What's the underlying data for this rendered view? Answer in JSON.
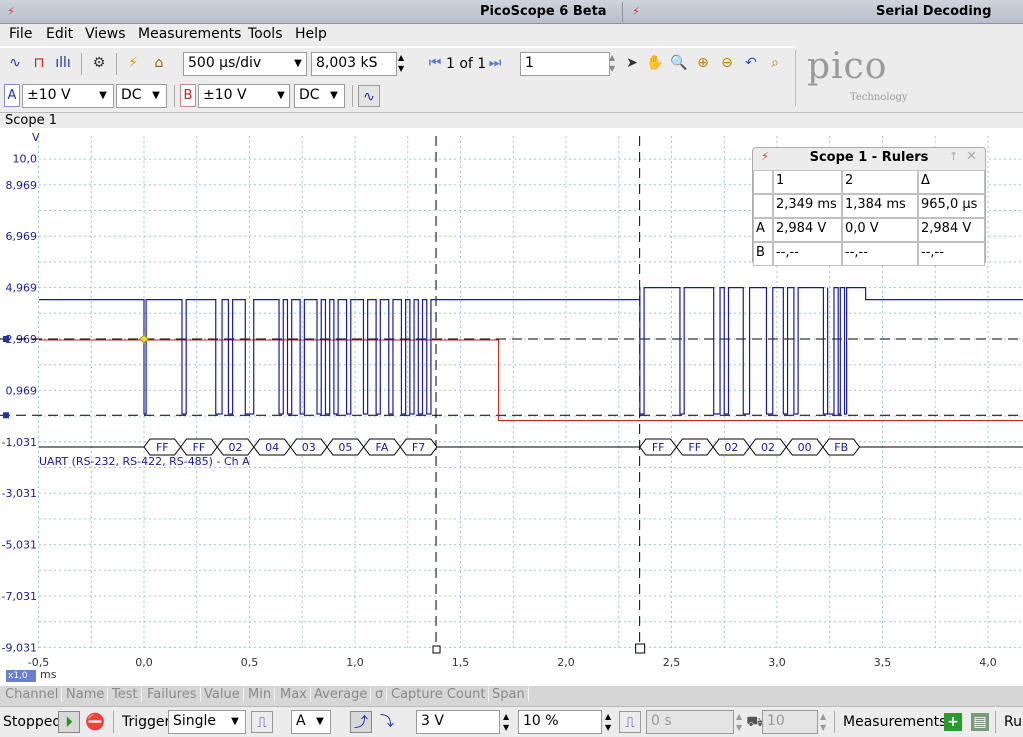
{
  "title_bar": {
    "app_title": "PicoScope 6 Beta",
    "window_title": "Serial Decoding"
  },
  "menu": [
    "File",
    "Edit",
    "Views",
    "Measurements",
    "Tools",
    "Help"
  ],
  "toolbar1": {
    "timebase": "500 µs/div",
    "samples": "8,003 kS",
    "capture_index": "1 of 1",
    "capture_count": "1"
  },
  "toolbar2": {
    "chA": {
      "letter": "A",
      "range": "±10 V",
      "coupling": "DC"
    },
    "chB": {
      "letter": "B",
      "range": "±10 V",
      "coupling": "DC"
    }
  },
  "logo": {
    "main": "pico",
    "sub": "Technology"
  },
  "scope": {
    "label": "Scope 1",
    "y_unit": "V",
    "x_unit": "ms",
    "zoom": "x1,0"
  },
  "axes": {
    "y_ticks": [
      "10,0",
      "8,969",
      "6,969",
      "4,969",
      "2,969",
      "0,969",
      "-1,031",
      "-3,031",
      "-5,031",
      "-7,031",
      "-9,031"
    ],
    "x_ticks": [
      "-0,5",
      "0,0",
      "0,5",
      "1,0",
      "1,5",
      "2,0",
      "2,5",
      "3,0",
      "3,5",
      "4,0"
    ]
  },
  "decode": {
    "label": "UART (RS-232, RS-422, RS-485) - Ch A",
    "packet1": [
      "FF",
      "FF",
      "02",
      "04",
      "03",
      "05",
      "FA",
      "F7"
    ],
    "packet2": [
      "FF",
      "FF",
      "02",
      "02",
      "00",
      "FB"
    ]
  },
  "rulers": {
    "title": "Scope 1 - Rulers",
    "headers": [
      "1",
      "2",
      "Δ"
    ],
    "rows": [
      {
        "ch": "",
        "v": [
          "2,349 ms",
          "1,384 ms",
          "965,0 µs"
        ]
      },
      {
        "ch": "A",
        "v": [
          "2,984 V",
          "0,0 V",
          "2,984 V"
        ]
      },
      {
        "ch": "B",
        "v": [
          "--,--",
          "--,--",
          "--,--"
        ]
      }
    ]
  },
  "measurements_header": [
    "Channel",
    "Name",
    "Test",
    "Failures",
    "Value",
    "Min",
    "Max",
    "Average",
    "σ",
    "Capture Count",
    "Span"
  ],
  "status": {
    "state": "Stopped",
    "trigger_label": "Trigger",
    "trigger_mode": "Single",
    "trigger_channel": "A",
    "threshold": "3 V",
    "pretrigger": "10 %",
    "delay": "0 s",
    "hysteresis": "10",
    "measurements_label": "Measurements",
    "rulers_label": "Rul"
  },
  "colors": {
    "chA": "#1a1a9e",
    "chB": "#cc2222",
    "grid": "#9ec7d9",
    "axis_text": "#1a1a9e"
  }
}
